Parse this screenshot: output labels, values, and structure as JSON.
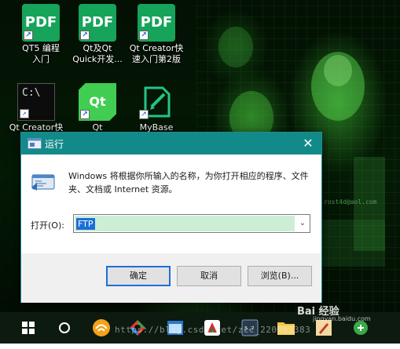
{
  "desktop_icons": [
    {
      "label": "QT5 编程入门",
      "tile": "PDF",
      "kind": "pdf"
    },
    {
      "label": "Qt及Qt Quick开发...",
      "tile": "PDF",
      "kind": "pdf"
    },
    {
      "label": "Qt Creator快速入门第2版",
      "tile": "PDF",
      "kind": "pdf"
    },
    {
      "label": "Qt Creator快速",
      "tile": "C:\\",
      "kind": "cmd"
    },
    {
      "label": "Qt",
      "tile": "Qt",
      "kind": "qt"
    },
    {
      "label": "MyBase",
      "tile": "",
      "kind": "mybase"
    }
  ],
  "wallpaper": {
    "caption": "rost4d@aol.com"
  },
  "run_dialog": {
    "title": "运行",
    "description": "Windows 将根据你所输入的名称，为你打开相应的程序、文件夹、文档或 Internet 资源。",
    "open_label": "打开(O):",
    "open_value": "FTP",
    "buttons": {
      "ok": "确定",
      "cancel": "取消",
      "browse": "浏览(B)..."
    }
  },
  "taskbar": {
    "items": [
      "windows-start",
      "cortana",
      "browser",
      "app-colorful",
      "app-window",
      "app-rocket",
      "app-terminal",
      "file-explorer",
      "app-paint",
      "app-green"
    ]
  },
  "overlay": {
    "watermark": "https://blog.csdn.net/zcc_220993383",
    "baidu": "Bai 经验",
    "baidu_sub": "jingyan.baidu.com"
  },
  "colors": {
    "titlebar": "#138a8a",
    "accent": "#1c6fd8",
    "pdf_green": "#16a35a"
  }
}
